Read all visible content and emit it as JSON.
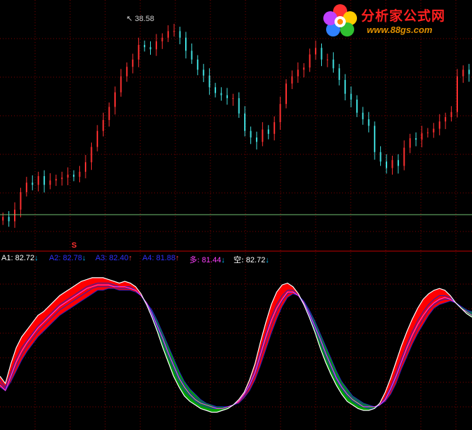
{
  "watermark": {
    "title": "分析家公式网",
    "url": "www.88gs.com"
  },
  "price_panel": {
    "high_marker": "38.58",
    "signal_marker": "S"
  },
  "indicator_legend": [
    {
      "label": "A1:",
      "value": "82.72",
      "arrow": "↓",
      "color": "#ffffff",
      "arrow_color": "#00c0ff"
    },
    {
      "label": "A2:",
      "value": "82.78",
      "arrow": "↓",
      "color": "#3030ff",
      "arrow_color": "#00c0ff"
    },
    {
      "label": "A3:",
      "value": "82.40",
      "arrow": "↑",
      "color": "#3030ff",
      "arrow_color": "#ff4040"
    },
    {
      "label": "A4:",
      "value": "81.88",
      "arrow": "↑",
      "color": "#3030ff",
      "arrow_color": "#ff4040"
    },
    {
      "label": "多:",
      "value": "81.44",
      "arrow": "↓",
      "color": "#ff40ff",
      "arrow_color": "#00c0ff"
    },
    {
      "label": "空:",
      "value": "82.72",
      "arrow": "↓",
      "color": "#ffffff",
      "arrow_color": "#00c0ff"
    }
  ],
  "colors": {
    "up": "#ff3030",
    "down": "#40e0e0",
    "bull_fill": "#ff0000",
    "bear_fill": "#00a000",
    "grid": "#800000",
    "base_line": "#70c070"
  },
  "chart_data": [
    {
      "type": "candlestick",
      "title": "",
      "annotations": [
        "38.58",
        "S"
      ],
      "close": [
        11,
        10.4,
        12,
        14.4,
        15.7,
        15.4,
        16.6,
        15.4,
        16,
        16.2,
        16.4,
        16.8,
        16.5,
        17.2,
        18.5,
        20.6,
        22.8,
        24.3,
        26.1,
        28.1,
        30.3,
        31.6,
        32.6,
        34.6,
        34.3,
        34,
        35.1,
        35.6,
        36.5,
        36.5,
        35.6,
        33.8,
        32.6,
        31.2,
        30.4,
        28.8,
        28,
        27.7,
        27.3,
        27.3,
        25.2,
        22.8,
        21.9,
        21.3,
        23,
        22.4,
        24,
        26.5,
        29.3,
        30.3,
        31.2,
        31.5,
        33.3,
        34.2,
        32.6,
        32.6,
        31.4,
        29.8,
        27.9,
        27.1,
        25.3,
        24.4,
        23.5,
        19.9,
        18.6,
        17.7,
        18.8,
        18,
        20.5,
        21.8,
        21.6,
        22.5,
        22.6,
        23.1,
        24.1,
        24.7,
        25.4,
        30.3,
        31.2,
        30.6
      ],
      "ylim": [
        9,
        40
      ],
      "n_bars": 80
    },
    {
      "type": "area",
      "title": "",
      "series": [
        {
          "name": "A1",
          "values": [
            38,
            34,
            45,
            54,
            60,
            64,
            68,
            72,
            74,
            77,
            80,
            83,
            85,
            87,
            89,
            91,
            92,
            93,
            93,
            93,
            92,
            91,
            90,
            91,
            90,
            88,
            84,
            78,
            71,
            63,
            54,
            46,
            38,
            32,
            27,
            24,
            22,
            20,
            19,
            18,
            18,
            19,
            20,
            22,
            25,
            29,
            36,
            45,
            57,
            68,
            78,
            85,
            89,
            90,
            88,
            84,
            78,
            71,
            63,
            54,
            46,
            39,
            33,
            28,
            24,
            22,
            20,
            19,
            19,
            20,
            23,
            29,
            37,
            46,
            55,
            63,
            70,
            76,
            81,
            84,
            86,
            87,
            86,
            83,
            79,
            76,
            73,
            71
          ]
        },
        {
          "name": "A2",
          "values": [
            36,
            32,
            40,
            48,
            54,
            58,
            62,
            66,
            69,
            72,
            75,
            78,
            80,
            82,
            84,
            86,
            88,
            89,
            90,
            90,
            90,
            89,
            88,
            88,
            88,
            86,
            83,
            78,
            72,
            65,
            57,
            49,
            42,
            35,
            30,
            27,
            24,
            22,
            21,
            20,
            20,
            20,
            21,
            22,
            24,
            28,
            34,
            42,
            52,
            62,
            71,
            78,
            83,
            86,
            86,
            83,
            78,
            72,
            65,
            57,
            49,
            42,
            36,
            31,
            27,
            24,
            22,
            21,
            20,
            20,
            22,
            26,
            32,
            40,
            48,
            56,
            63,
            69,
            74,
            78,
            81,
            83,
            83,
            82,
            79,
            76,
            74,
            72
          ]
        },
        {
          "name": "A3",
          "values": [
            34,
            31,
            37,
            44,
            50,
            55,
            59,
            63,
            66,
            69,
            72,
            75,
            77,
            79,
            81,
            83,
            85,
            87,
            88,
            88,
            88,
            88,
            87,
            87,
            87,
            86,
            83,
            79,
            74,
            67,
            60,
            52,
            45,
            38,
            33,
            29,
            26,
            24,
            22,
            21,
            21,
            21,
            21,
            22,
            24,
            27,
            32,
            39,
            48,
            57,
            66,
            74,
            80,
            84,
            85,
            83,
            79,
            74,
            67,
            60,
            52,
            45,
            38,
            33,
            29,
            26,
            24,
            22,
            21,
            21,
            22,
            25,
            30,
            37,
            45,
            52,
            59,
            65,
            70,
            75,
            78,
            80,
            81,
            81,
            79,
            77,
            75,
            73
          ]
        },
        {
          "name": "A4",
          "values": [
            32,
            30,
            35,
            41,
            47,
            52,
            56,
            60,
            63,
            66,
            69,
            72,
            74,
            76,
            78,
            80,
            82,
            84,
            86,
            86,
            87,
            87,
            86,
            86,
            86,
            85,
            83,
            79,
            75,
            69,
            62,
            55,
            48,
            41,
            35,
            31,
            28,
            25,
            23,
            22,
            21,
            21,
            21,
            22,
            23,
            26,
            30,
            36,
            44,
            53,
            62,
            70,
            77,
            82,
            84,
            83,
            80,
            75,
            69,
            62,
            55,
            48,
            41,
            35,
            31,
            27,
            25,
            23,
            22,
            21,
            22,
            24,
            28,
            34,
            42,
            49,
            56,
            62,
            67,
            72,
            76,
            78,
            79,
            80,
            79,
            77,
            75,
            74
          ]
        },
        {
          "name": "多",
          "values": [
            33,
            30,
            38,
            46,
            52,
            57,
            61,
            65,
            68,
            71,
            74,
            77,
            79,
            81,
            83,
            85,
            87,
            88,
            89,
            89,
            89,
            88,
            88,
            88,
            87,
            86,
            83,
            79,
            73,
            66,
            59,
            51,
            44,
            37,
            32,
            28,
            25,
            23,
            22,
            21,
            20,
            20,
            21,
            22,
            24,
            28,
            33,
            40,
            50,
            60,
            69,
            76,
            81,
            85,
            85,
            83,
            79,
            73,
            66,
            59,
            51,
            44,
            37,
            32,
            28,
            25,
            23,
            21,
            21,
            21,
            22,
            25,
            31,
            38,
            46,
            54,
            61,
            67,
            72,
            76,
            79,
            81,
            82,
            81,
            79,
            76,
            74,
            72
          ]
        },
        {
          "name": "空",
          "values": [
            38,
            34,
            45,
            54,
            60,
            64,
            68,
            72,
            74,
            77,
            80,
            83,
            85,
            87,
            89,
            91,
            92,
            93,
            93,
            93,
            92,
            91,
            90,
            91,
            90,
            88,
            84,
            78,
            71,
            63,
            54,
            46,
            38,
            32,
            27,
            24,
            22,
            20,
            19,
            18,
            18,
            19,
            20,
            22,
            25,
            29,
            36,
            45,
            57,
            68,
            78,
            85,
            89,
            90,
            88,
            84,
            78,
            71,
            63,
            54,
            46,
            39,
            33,
            28,
            24,
            22,
            20,
            19,
            19,
            20,
            23,
            29,
            37,
            46,
            55,
            63,
            70,
            76,
            81,
            84,
            86,
            87,
            86,
            83,
            79,
            76,
            73,
            71
          ]
        }
      ],
      "ylim": [
        10,
        100
      ]
    }
  ]
}
